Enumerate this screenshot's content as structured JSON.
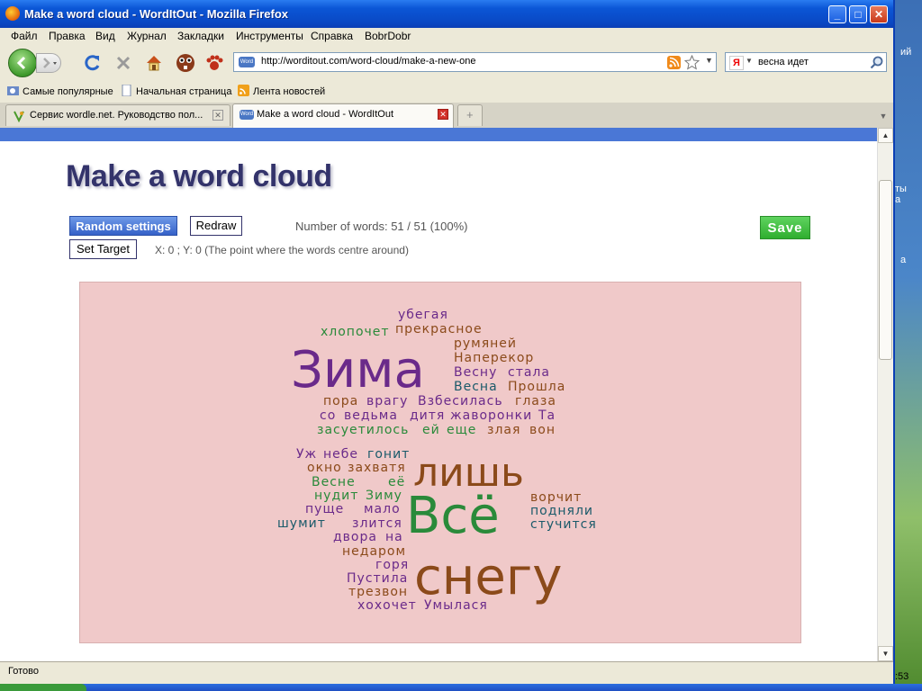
{
  "window": {
    "title": "Make a word cloud - WordItOut - Mozilla Firefox"
  },
  "menu": [
    "Файл",
    "Правка",
    "Вид",
    "Журнал",
    "Закладки",
    "Инструменты",
    "Справка",
    "BobrDobr"
  ],
  "nav": {
    "url": "http://worditout.com/word-cloud/make-a-new-one",
    "search_engine": "Я",
    "search_query": "весна идет",
    "favicon_text": "Word"
  },
  "bookmarks": [
    "Самые популярные",
    "Начальная страница",
    "Лента новостей"
  ],
  "tabs": [
    {
      "label": "Сервис wordle.net. Руководство пол...",
      "active": false
    },
    {
      "label": "Make a word cloud - WordItOut",
      "active": true
    }
  ],
  "page": {
    "title": "Make a word cloud",
    "random_settings": "Random settings",
    "redraw": "Redraw",
    "set_target": "Set Target",
    "save": "Save",
    "word_count": "Number of words: 51 / 51 (100%)",
    "target_info": "X: 0 ; Y: 0 (The point where the words centre around)"
  },
  "status": {
    "text": "Готово",
    "clock": ":53"
  },
  "desktop_fragments": [
    "ий",
    "ты",
    "а",
    "а"
  ],
  "colors": {
    "purple": "#6a2a8a",
    "brown": "#8b4a1a",
    "green": "#2a8a3a",
    "teal": "#1a5a6a",
    "cloud_bg": "#f0c9c9",
    "title_color": "#33336b"
  },
  "cloud_words": [
    {
      "text": "убегая",
      "color": "purple"
    },
    {
      "text": "хлопочет",
      "color": "green"
    },
    {
      "text": "прекрасное",
      "color": "brown"
    },
    {
      "text": "румяней",
      "color": "brown"
    },
    {
      "text": "Зима",
      "color": "purple"
    },
    {
      "text": "Наперекор",
      "color": "brown"
    },
    {
      "text": "Весну",
      "color": "purple"
    },
    {
      "text": "стала",
      "color": "purple"
    },
    {
      "text": "Весна",
      "color": "teal"
    },
    {
      "text": "Прошла",
      "color": "brown"
    },
    {
      "text": "пора",
      "color": "brown"
    },
    {
      "text": "врагу",
      "color": "purple"
    },
    {
      "text": "Взбесилась",
      "color": "purple"
    },
    {
      "text": "глаза",
      "color": "brown"
    },
    {
      "text": "со",
      "color": "purple"
    },
    {
      "text": "ведьма",
      "color": "purple"
    },
    {
      "text": "дитя",
      "color": "purple"
    },
    {
      "text": "жаворонки",
      "color": "purple"
    },
    {
      "text": "Та",
      "color": "purple"
    },
    {
      "text": "засуетилось",
      "color": "green"
    },
    {
      "text": "ей",
      "color": "green"
    },
    {
      "text": "еще",
      "color": "green"
    },
    {
      "text": "злая",
      "color": "brown"
    },
    {
      "text": "вон",
      "color": "brown"
    },
    {
      "text": "Уж",
      "color": "purple"
    },
    {
      "text": "небе",
      "color": "purple"
    },
    {
      "text": "гонит",
      "color": "teal"
    },
    {
      "text": "окно",
      "color": "brown"
    },
    {
      "text": "захватя",
      "color": "brown"
    },
    {
      "text": "лишь",
      "color": "brown"
    },
    {
      "text": "Весне",
      "color": "green"
    },
    {
      "text": "её",
      "color": "green"
    },
    {
      "text": "нудит",
      "color": "green"
    },
    {
      "text": "Зиму",
      "color": "green"
    },
    {
      "text": "ворчит",
      "color": "brown"
    },
    {
      "text": "пуще",
      "color": "purple"
    },
    {
      "text": "мало",
      "color": "purple"
    },
    {
      "text": "подняли",
      "color": "teal"
    },
    {
      "text": "шумит",
      "color": "teal"
    },
    {
      "text": "злится",
      "color": "purple"
    },
    {
      "text": "Всё",
      "color": "green"
    },
    {
      "text": "стучится",
      "color": "teal"
    },
    {
      "text": "двора",
      "color": "purple"
    },
    {
      "text": "на",
      "color": "purple"
    },
    {
      "text": "недаром",
      "color": "brown"
    },
    {
      "text": "горя",
      "color": "purple"
    },
    {
      "text": "Пустила",
      "color": "purple"
    },
    {
      "text": "снегу",
      "color": "brown"
    },
    {
      "text": "трезвон",
      "color": "brown"
    },
    {
      "text": "хохочет",
      "color": "purple"
    },
    {
      "text": "Умылася",
      "color": "purple"
    }
  ]
}
